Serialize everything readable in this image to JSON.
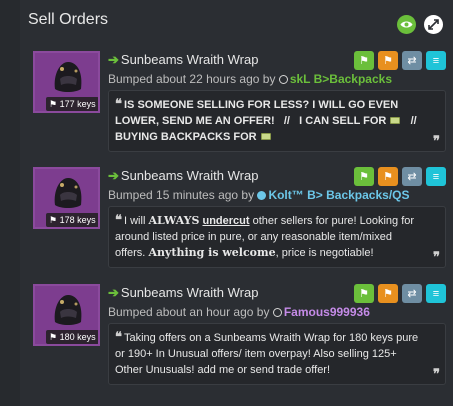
{
  "header": {
    "title": "Sell Orders"
  },
  "listings": [
    {
      "item_name": "Sunbeams Wraith Wrap",
      "price_badge": "177 keys",
      "bump_prefix": "Bumped about 22 hours ago by",
      "user_name": "skL B>Backpacks",
      "user_color": "#6bbf3b",
      "status": "offline",
      "comment_parts": [
        "IS SOMEONE SELLING FOR LESS? I WILL GO EVEN LOWER, SEND ME AN OFFER!",
        "//",
        "I CAN SELL FOR",
        "//",
        "BUYING BACKPACKS FOR"
      ]
    },
    {
      "item_name": "Sunbeams Wraith Wrap",
      "price_badge": "178 keys",
      "bump_prefix": "Bumped 15 minutes ago by",
      "user_name": "Kolt™ B> Backpacks/QS",
      "user_color": "#6cc7e8",
      "status": "online",
      "comment_parts": [
        "I will",
        "ALWAYS",
        "undercut",
        "other sellers for pure! Looking for around listed price in pure, or any reasonable item/mixed offers.",
        "Anything is welcome",
        ", price is negotiable!"
      ]
    },
    {
      "item_name": "Sunbeams Wraith Wrap",
      "price_badge": "180 keys",
      "bump_prefix": "Bumped about an hour ago by",
      "user_name": "Famous999936",
      "user_color": "#c58be8",
      "status": "offline",
      "comment_parts": [
        "Taking offers on a Sunbeams Wraith Wrap for 180 keys pure or 190+ In Unusual offers/ item overpay! Also selling 125+ Other Unusuals! add me or send trade offer!"
      ]
    }
  ],
  "colors": {
    "accent_green": "#6bbf3b",
    "accent_orange": "#e8901f",
    "accent_gray": "#6f8ea3",
    "accent_cyan": "#1fc4d8"
  }
}
